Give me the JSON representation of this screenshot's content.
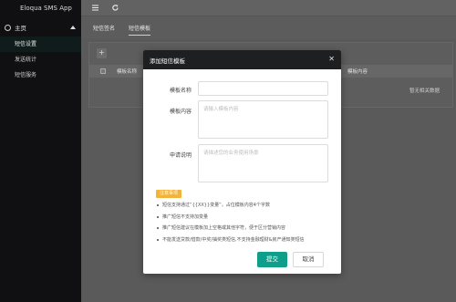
{
  "app": {
    "title": "Eloqua SMS App"
  },
  "sidebar": {
    "group_label": "主页",
    "items": [
      {
        "label": "短信设置",
        "active": true
      },
      {
        "label": "发送统计",
        "active": false
      },
      {
        "label": "短信服务",
        "active": false
      }
    ]
  },
  "topbar": {
    "menu_icon": "menu-icon",
    "refresh_icon": "refresh-icon"
  },
  "tabs": [
    {
      "label": "短信签名",
      "active": false
    },
    {
      "label": "短信模板",
      "active": true
    }
  ],
  "table": {
    "add_label": "+",
    "columns": [
      "模板名称",
      "模板内容"
    ],
    "empty_text": "暂无相关数据"
  },
  "modal": {
    "title": "添加短信模板",
    "close_icon": "close-icon",
    "fields": {
      "name": {
        "label": "模板名称",
        "value": ""
      },
      "content": {
        "label": "模板内容",
        "placeholder": "请输入模板内容"
      },
      "reason": {
        "label": "申请说明",
        "placeholder": "请描述您的业务使用场景"
      }
    },
    "notice_tag": "注意事项",
    "notes": [
      "短信支持通过“{{XX}}变量”，占位模板内容4个字数",
      "推广短信不支持加变量",
      "推广短信建议在模板加上空格或其他字符，便于区分营销内容",
      "不能发送贷款/借款/中奖/抽奖类短信,不支持金融理财&房产通知类短信"
    ],
    "submit_label": "提交",
    "cancel_label": "取消"
  },
  "colors": {
    "sidebar_bg": "#101012",
    "modal_header_bg": "#1e1f21",
    "primary_button": "#0e9e8a",
    "notice_tag": "#f3b23a"
  }
}
